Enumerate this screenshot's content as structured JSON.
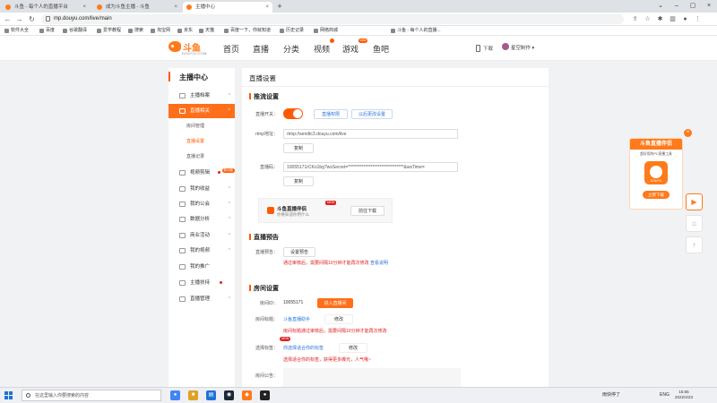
{
  "browser": {
    "tabs": [
      {
        "title": "斗鱼 - 每个人的直播平台",
        "active": false
      },
      {
        "title": "成为斗鱼主播 - 斗鱼",
        "active": false
      },
      {
        "title": "主播中心",
        "active": true
      }
    ],
    "url": "mp.douyu.com/live/main",
    "bookmarks": [
      "软件大全",
      "百度",
      "谷歌翻译",
      "爱学教程",
      "搜索",
      "淘宝网",
      "京东",
      "天猫",
      "百度一下，你就知道",
      "历史记录",
      "网络商城",
      "斗鱼 - 每个人的直播..."
    ]
  },
  "header": {
    "logo_cn": "斗鱼",
    "logo_en": "DOUYU.COM",
    "nav": [
      "首页",
      "直播",
      "分类",
      "视频",
      "游戏",
      "鱼吧"
    ],
    "game_badge": "new",
    "download_label": "下载",
    "user_label": "星空制作"
  },
  "sidebar": {
    "title": "主播中心",
    "items": [
      {
        "label": "主播档案"
      },
      {
        "label": "直播相关",
        "active": true
      },
      {
        "label": "视频剪辑",
        "badge": "新功能"
      },
      {
        "label": "我的收益"
      },
      {
        "label": "我的公会"
      },
      {
        "label": "数据分析"
      },
      {
        "label": "商业活动"
      },
      {
        "label": "我的视频"
      },
      {
        "label": "我的推广"
      },
      {
        "label": "主播扶持"
      },
      {
        "label": "直播管理"
      }
    ],
    "subitems": [
      {
        "label": "房间管理"
      },
      {
        "label": "直播设置",
        "active": true
      },
      {
        "label": "直播记录"
      }
    ]
  },
  "main": {
    "title": "直播设置",
    "push": {
      "heading": "推流设置",
      "switch_label": "直播开关：",
      "switch_on": true,
      "btn_rtmp": "直播权限",
      "btn_os": "以后更改设置",
      "rtmp_label": "rtmp地址：",
      "rtmp_value": "rtmp://sendtc3.douyu.com/live",
      "copy1": "复制",
      "code_label": "直播码：",
      "code_value": "10055171rCKo1bg?wsSecret=********************************&wsTime=",
      "copy2": "复制"
    },
    "companion": {
      "title": "斗鱼直播伴侣",
      "desc": "你要知道你用什么",
      "new_tag": "NEW",
      "download_btn": "前往下载"
    },
    "preview": {
      "heading": "直播预告",
      "label": "直播预告：",
      "btn": "设置预告",
      "note": "通过审核后，需要间隔10分钟才能再次修改",
      "note_link": "查看说明"
    },
    "room": {
      "heading": "房间设置",
      "id_label": "房间ID：",
      "id_value": "10055171",
      "enter_btn": "进入直播间",
      "title_label": "房间标题：",
      "title_value": "斗鱼直播助手",
      "edit1": "修改",
      "title_note": "房间标题通过审核后，需要间隔10分钟才能再次修改",
      "cat_label": "选择标签：",
      "cat_new": "NEW",
      "cat_value": "你选择适合你的标签",
      "edit2": "修改",
      "cat_note": "选择适合你的标签，获得更多曝光，人气哦~",
      "notice_label": "房间公告："
    }
  },
  "promo": {
    "title": "斗鱼直播伴侣",
    "desc": "超好用的PC直播工具",
    "img_label": "DOUYU",
    "btn": "立即下载",
    "close": "×"
  },
  "floating": [
    "▶",
    "⌂",
    "↑"
  ],
  "taskbar": {
    "search_placeholder": "在这里输入你要搜索的内容",
    "weather": "雨快停了",
    "lang": "ENG",
    "time": "15:55",
    "date": "2022/4/23"
  },
  "colors": {
    "accent": "#ff6f1a",
    "link": "#2a73d9",
    "warn": "#e02020"
  }
}
